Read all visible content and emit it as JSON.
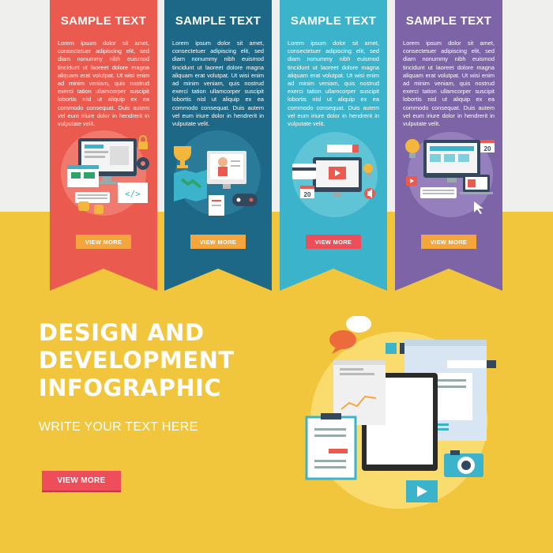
{
  "banners": [
    {
      "title": "SAMPLE TEXT",
      "body": "Lorem ipsum dolor sit amet, consectetuer adipiscing elit, sed diam nonummy nibh euismod tincidunt ut laoreet dolore magna aliquam erat volutpat. Ut wisi enim ad minim veniam, quis nostrud exerci tation ullamcorper suscipit lobortis nisl ut aliquip ex ea commodo consequat. Duis autem vel eum iriure dolor in hendrerit in vulputate velit.",
      "button": "VIEW MORE",
      "color": "#ea5a4f",
      "button_color": "#f4a53c",
      "calendar_day": ""
    },
    {
      "title": "SAMPLE TEXT",
      "body": "Lorem ipsum dolor sit amet, consectetuer adipiscing elit, sed diam nonummy nibh euismod tincidunt ut laoreet dolore magna aliquam erat volutpat. Ut wisi enim ad minim veniam, quis nostrud exerci tation ullamcorper suscipit lobortis nisl ut aliquip ex ea commodo consequat. Duis autem vel eum iriure dolor in hendrerit in vulputate velit.",
      "button": "VIEW MORE",
      "color": "#1d6887",
      "button_color": "#f4a53c",
      "calendar_day": ""
    },
    {
      "title": "SAMPLE TEXT",
      "body": "Lorem ipsum dolor sit amet, consectetuer adipiscing elit, sed diam nonummy nibh euismod tincidunt ut laoreet dolore magna aliquam erat volutpat. Ut wisi enim ad minim veniam, quis nostrud exerci tation ullamcorper suscipit lobortis nisl ut aliquip ex ea commodo consequat. Duis autem vel eum iriure dolor in hendrerit in vulputate velit.",
      "button": "VIEW MORE",
      "color": "#3bb3ca",
      "button_color": "#ed4e5a",
      "calendar_day": "20"
    },
    {
      "title": "SAMPLE TEXT",
      "body": "Lorem ipsum dolor sit amet, consectetuer adipiscing elit, sed diam nonummy nibh euismod tincidunt ut laoreet dolore magna aliquam erat volutpat. Ut wisi enim ad minim veniam, quis nostrud exerci tation ullamcorper suscipit lobortis nisl ut aliquip ex ea commodo consequat. Duis autem vel eum iriure dolor in hendrerit in vulputate velit.",
      "button": "VIEW MORE",
      "color": "#7d64a6",
      "button_color": "#f4a53c",
      "calendar_day": "20"
    }
  ],
  "main": {
    "title_lines": [
      "DESIGN AND",
      "DEVELOPMENT",
      "INFOGRAPHIC"
    ],
    "subtitle": "WRITE YOUR TEXT HERE",
    "button": "VIEW MORE"
  },
  "colors": {
    "background_top": "#efefee",
    "background_bottom": "#f2c63c",
    "main_button": "#ed4e5a"
  },
  "icons": {
    "banner_0": [
      "monitor-icon",
      "keyboard-icon",
      "code-window-icon",
      "lock-icon",
      "gear-icon",
      "hand-icon"
    ],
    "banner_1": [
      "trophy-icon",
      "monitor-icon",
      "map-icon",
      "gamepad-icon",
      "clipboard-icon"
    ],
    "banner_2": [
      "monitor-icon",
      "video-play-icon",
      "lightbulb-icon",
      "calendar-icon",
      "speaker-icon",
      "credit-card-icon"
    ],
    "banner_3": [
      "lightbulb-icon",
      "monitor-icon",
      "laptop-icon",
      "calendar-icon",
      "keyboard-icon",
      "cursor-icon"
    ],
    "hero": [
      "speech-bubble-icon",
      "chart-window-icon",
      "clipboard-icon",
      "tablet-icon",
      "browser-window-icon",
      "camera-icon",
      "video-play-icon"
    ]
  }
}
